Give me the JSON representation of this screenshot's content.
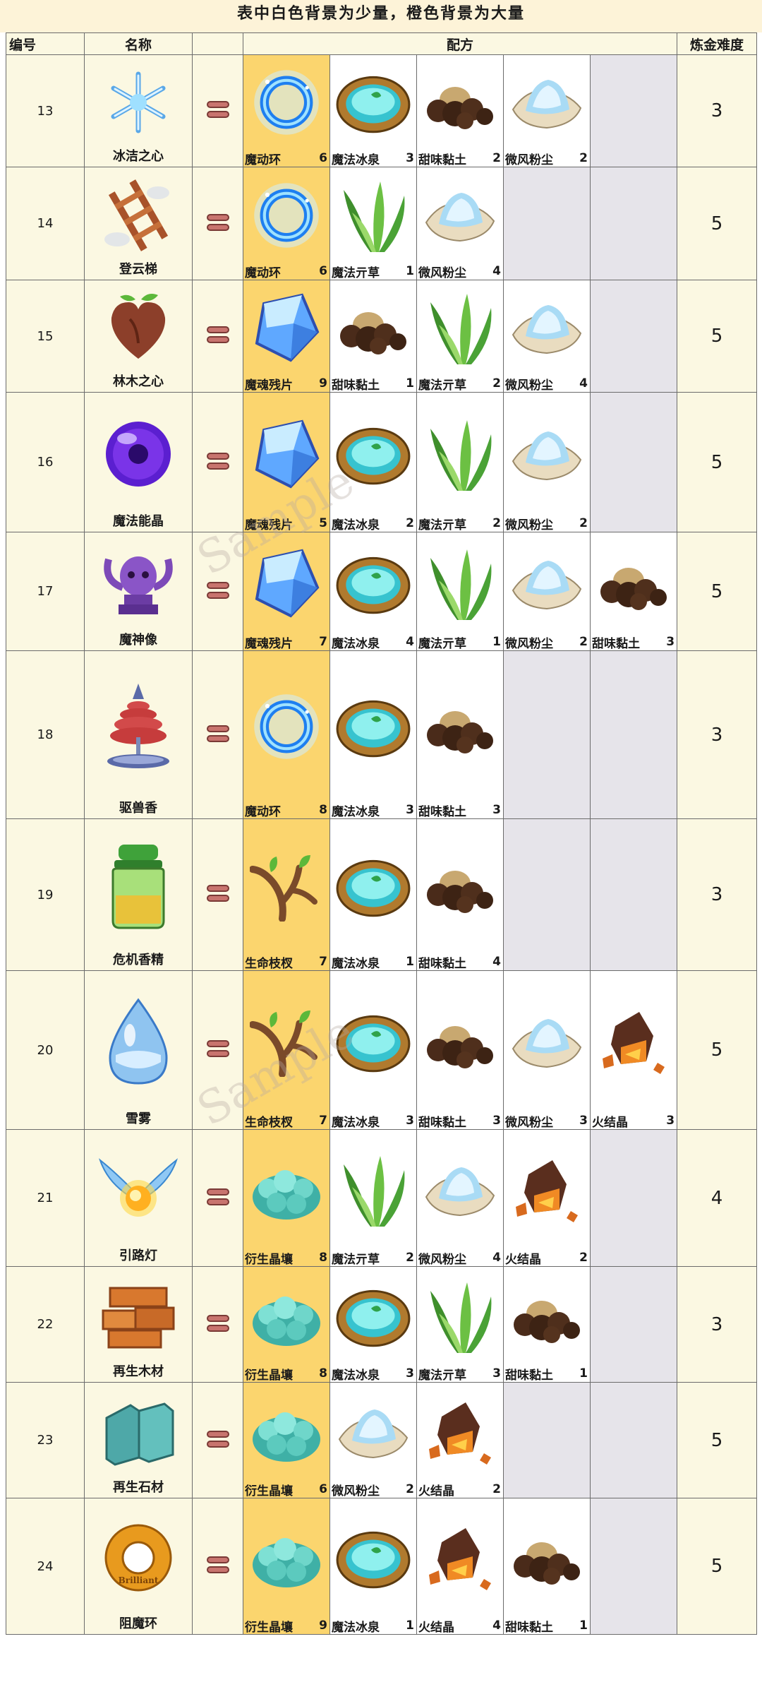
{
  "header_note": "表中白色背景为少量，橙色背景为大量",
  "columns": {
    "num": "编号",
    "name": "名称",
    "recipe": "配方",
    "difficulty": "炼金难度"
  },
  "watermark": "Sample",
  "colors": {
    "major_bg": "#fbd56e",
    "minor_bg": "#ffffff",
    "empty_bg": "#e6e4ea",
    "header_bg": "#fbf8e2"
  },
  "rows": [
    {
      "id": "13",
      "name": "冰洁之心",
      "icon": "snowflake-icon",
      "difficulty": "3",
      "ingredients": [
        {
          "name": "魔动环",
          "qty": "6",
          "icon": "magic-ring-icon",
          "major": true
        },
        {
          "name": "魔法冰泉",
          "qty": "3",
          "icon": "ice-spring-icon",
          "major": false
        },
        {
          "name": "甜味黏土",
          "qty": "2",
          "icon": "sweet-clay-icon",
          "major": false
        },
        {
          "name": "微风粉尘",
          "qty": "2",
          "icon": "breeze-dust-icon",
          "major": false
        }
      ]
    },
    {
      "id": "14",
      "name": "登云梯",
      "icon": "cloud-ladder-icon",
      "difficulty": "5",
      "ingredients": [
        {
          "name": "魔动环",
          "qty": "6",
          "icon": "magic-ring-icon",
          "major": true
        },
        {
          "name": "魔法亓草",
          "qty": "1",
          "icon": "magic-grass-icon",
          "major": false
        },
        {
          "name": "微风粉尘",
          "qty": "4",
          "icon": "breeze-dust-icon",
          "major": false
        }
      ]
    },
    {
      "id": "15",
      "name": "林木之心",
      "icon": "wood-heart-icon",
      "difficulty": "5",
      "ingredients": [
        {
          "name": "魔魂残片",
          "qty": "9",
          "icon": "soul-shard-icon",
          "major": true
        },
        {
          "name": "甜味黏土",
          "qty": "1",
          "icon": "sweet-clay-icon",
          "major": false
        },
        {
          "name": "魔法亓草",
          "qty": "2",
          "icon": "magic-grass-icon",
          "major": false
        },
        {
          "name": "微风粉尘",
          "qty": "4",
          "icon": "breeze-dust-icon",
          "major": false
        }
      ]
    },
    {
      "id": "16",
      "name": "魔法能晶",
      "icon": "magic-orb-icon",
      "difficulty": "5",
      "ingredients": [
        {
          "name": "魔魂残片",
          "qty": "5",
          "icon": "soul-shard-icon",
          "major": true
        },
        {
          "name": "魔法冰泉",
          "qty": "2",
          "icon": "ice-spring-icon",
          "major": false
        },
        {
          "name": "魔法亓草",
          "qty": "2",
          "icon": "magic-grass-icon",
          "major": false
        },
        {
          "name": "微风粉尘",
          "qty": "2",
          "icon": "breeze-dust-icon",
          "major": false
        }
      ]
    },
    {
      "id": "17",
      "name": "魔神像",
      "icon": "demon-statue-icon",
      "difficulty": "5",
      "ingredients": [
        {
          "name": "魔魂残片",
          "qty": "7",
          "icon": "soul-shard-icon",
          "major": true
        },
        {
          "name": "魔法冰泉",
          "qty": "4",
          "icon": "ice-spring-icon",
          "major": false
        },
        {
          "name": "魔法亓草",
          "qty": "1",
          "icon": "magic-grass-icon",
          "major": false
        },
        {
          "name": "微风粉尘",
          "qty": "2",
          "icon": "breeze-dust-icon",
          "major": false
        },
        {
          "name": "甜味黏土",
          "qty": "3",
          "icon": "sweet-clay-icon",
          "major": false
        }
      ]
    },
    {
      "id": "18",
      "name": "驱兽香",
      "icon": "incense-coil-icon",
      "difficulty": "3",
      "ingredients": [
        {
          "name": "魔动环",
          "qty": "8",
          "icon": "magic-ring-icon",
          "major": true
        },
        {
          "name": "魔法冰泉",
          "qty": "3",
          "icon": "ice-spring-icon",
          "major": false
        },
        {
          "name": "甜味黏土",
          "qty": "3",
          "icon": "sweet-clay-icon",
          "major": false
        }
      ]
    },
    {
      "id": "19",
      "name": "危机香精",
      "icon": "essence-jar-icon",
      "difficulty": "3",
      "ingredients": [
        {
          "name": "生命枝杈",
          "qty": "7",
          "icon": "life-branch-icon",
          "major": true
        },
        {
          "name": "魔法冰泉",
          "qty": "1",
          "icon": "ice-spring-icon",
          "major": false
        },
        {
          "name": "甜味黏土",
          "qty": "4",
          "icon": "sweet-clay-icon",
          "major": false
        }
      ]
    },
    {
      "id": "20",
      "name": "雪雾",
      "icon": "snow-mist-drop-icon",
      "difficulty": "5",
      "ingredients": [
        {
          "name": "生命枝杈",
          "qty": "7",
          "icon": "life-branch-icon",
          "major": true
        },
        {
          "name": "魔法冰泉",
          "qty": "3",
          "icon": "ice-spring-icon",
          "major": false
        },
        {
          "name": "甜味黏土",
          "qty": "3",
          "icon": "sweet-clay-icon",
          "major": false
        },
        {
          "name": "微风粉尘",
          "qty": "3",
          "icon": "breeze-dust-icon",
          "major": false
        },
        {
          "name": "火结晶",
          "qty": "3",
          "icon": "fire-crystal-icon",
          "major": false
        }
      ]
    },
    {
      "id": "21",
      "name": "引路灯",
      "icon": "winged-lamp-icon",
      "difficulty": "4",
      "ingredients": [
        {
          "name": "衍生晶壤",
          "qty": "8",
          "icon": "crystal-soil-icon",
          "major": true
        },
        {
          "name": "魔法亓草",
          "qty": "2",
          "icon": "magic-grass-icon",
          "major": false
        },
        {
          "name": "微风粉尘",
          "qty": "4",
          "icon": "breeze-dust-icon",
          "major": false
        },
        {
          "name": "火结晶",
          "qty": "2",
          "icon": "fire-crystal-icon",
          "major": false
        }
      ]
    },
    {
      "id": "22",
      "name": "再生木材",
      "icon": "wood-planks-icon",
      "difficulty": "3",
      "ingredients": [
        {
          "name": "衍生晶壤",
          "qty": "8",
          "icon": "crystal-soil-icon",
          "major": true
        },
        {
          "name": "魔法冰泉",
          "qty": "3",
          "icon": "ice-spring-icon",
          "major": false
        },
        {
          "name": "魔法亓草",
          "qty": "3",
          "icon": "magic-grass-icon",
          "major": false
        },
        {
          "name": "甜味黏土",
          "qty": "1",
          "icon": "sweet-clay-icon",
          "major": false
        }
      ]
    },
    {
      "id": "23",
      "name": "再生石材",
      "icon": "stone-blocks-icon",
      "difficulty": "5",
      "ingredients": [
        {
          "name": "衍生晶壤",
          "qty": "6",
          "icon": "crystal-soil-icon",
          "major": true
        },
        {
          "name": "微风粉尘",
          "qty": "2",
          "icon": "breeze-dust-icon",
          "major": false
        },
        {
          "name": "火结晶",
          "qty": "2",
          "icon": "fire-crystal-icon",
          "major": false
        }
      ]
    },
    {
      "id": "24",
      "name": "阻魔环",
      "icon": "brilliant-ring-icon",
      "ring_text": "Brilliant",
      "difficulty": "5",
      "ingredients": [
        {
          "name": "衍生晶壤",
          "qty": "9",
          "icon": "crystal-soil-icon",
          "major": true
        },
        {
          "name": "魔法冰泉",
          "qty": "1",
          "icon": "ice-spring-icon",
          "major": false
        },
        {
          "name": "火结晶",
          "qty": "4",
          "icon": "fire-crystal-icon",
          "major": false
        },
        {
          "name": "甜味黏土",
          "qty": "1",
          "icon": "sweet-clay-icon",
          "major": false
        }
      ]
    }
  ]
}
